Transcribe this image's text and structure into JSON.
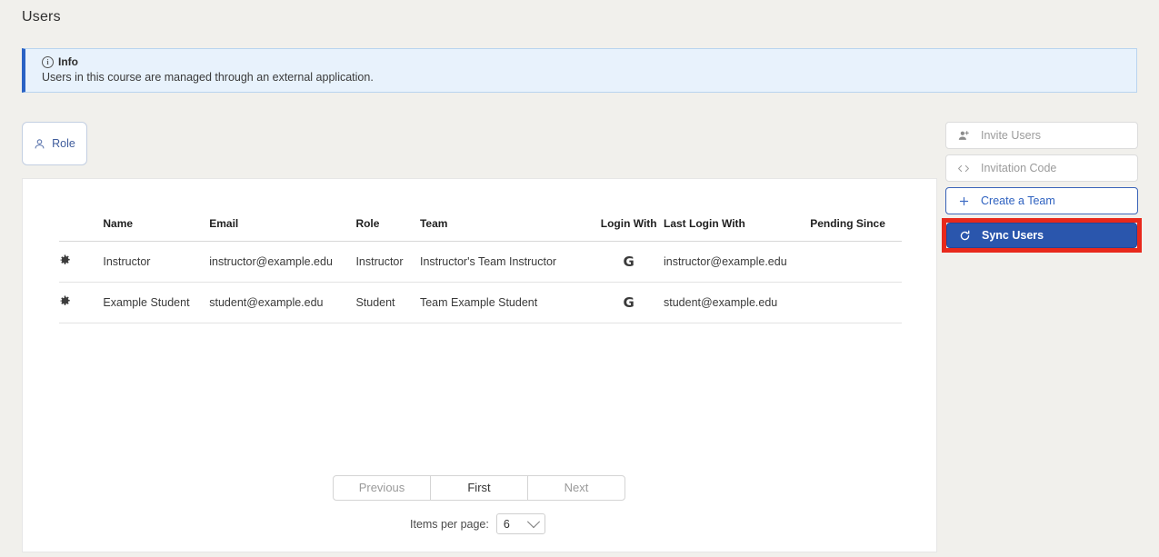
{
  "page": {
    "title": "Users",
    "background_color": "#f1f0ec"
  },
  "alert": {
    "icon": "info-circle-icon",
    "title": "Info",
    "message": "Users in this course are managed through an external application.",
    "background_color": "#e8f2fc",
    "accent_color": "#2a62c4"
  },
  "filters": {
    "role": {
      "label": "Role",
      "icon": "user-icon"
    }
  },
  "actions": [
    {
      "label": "Invite Users",
      "icon": "user-plus-icon",
      "state": "disabled"
    },
    {
      "label": "Invitation Code",
      "icon": "code-brackets-icon",
      "state": "disabled"
    },
    {
      "label": "Create a Team",
      "icon": "plus-icon",
      "state": "outline"
    },
    {
      "label": "Sync Users",
      "icon": "refresh-icon",
      "state": "primary"
    }
  ],
  "highlight": {
    "target": "Sync Users",
    "color": "#e8291c"
  },
  "table": {
    "columns": [
      "",
      "Name",
      "Email",
      "Role",
      "Team",
      "Login With",
      "Last Login With",
      "Pending Since"
    ],
    "rows": [
      {
        "gear": "gear-icon",
        "name": "Instructor",
        "email": "instructor@example.edu",
        "role": "Instructor",
        "team": "Instructor's Team Instructor",
        "login_with": "G",
        "last_login_with": "instructor@example.edu",
        "pending_since": ""
      },
      {
        "gear": "gear-icon",
        "name": "Example Student",
        "email": "student@example.edu",
        "role": "Student",
        "team": "Team Example Student",
        "login_with": "G",
        "last_login_with": "student@example.edu",
        "pending_since": ""
      }
    ]
  },
  "pagination": {
    "previous": "Previous",
    "first": "First",
    "next": "Next",
    "items_per_page_label": "Items per page:",
    "items_per_page_value": "6",
    "items_per_page_options": [
      "6"
    ]
  }
}
